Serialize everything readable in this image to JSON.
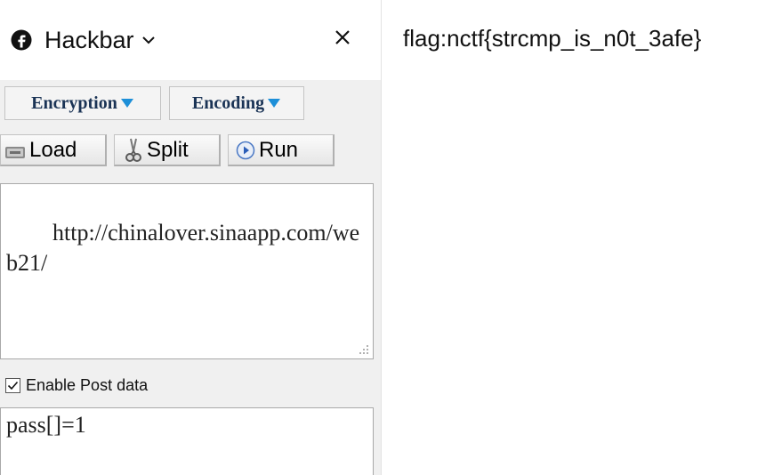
{
  "sidebar": {
    "title": "Hackbar",
    "icons": {
      "addon": "addon-icon",
      "dropdown": "chevron-down-icon",
      "close": "close-icon"
    }
  },
  "hackbar": {
    "menus": [
      {
        "label": "Encryption"
      },
      {
        "label": "Encoding"
      }
    ],
    "toolbar": {
      "load_label": "Load",
      "split_label": "Split",
      "run_label": "Run"
    },
    "url_value": "http://chinalover.sinaapp.com/web21/",
    "post_toggle": {
      "label": "Enable Post data",
      "checked": true
    },
    "post_value": "pass[]=1"
  },
  "page": {
    "body_text": "flag:nctf{strcmp_is_n0t_3afe}"
  },
  "colors": {
    "accent_triangle": "#1d8fd8",
    "menu_text": "#1a3355",
    "panel_bg": "#f0f0f0"
  }
}
